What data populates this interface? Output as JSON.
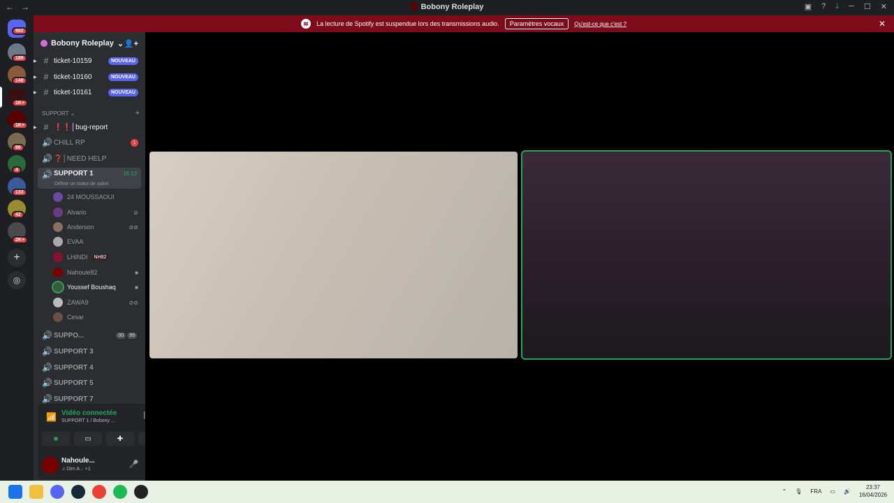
{
  "window": {
    "title": "Bobony Roleplay"
  },
  "banner": {
    "text": "La lecture de Spotify est suspendue lors des transmissions audio.",
    "button_label": "Paramètres vocaux",
    "link_text": "Qu'est-ce que c'est ?"
  },
  "guilds": {
    "badges": [
      "902",
      "189",
      "148",
      "1K+",
      "1K+",
      "86",
      "4",
      "133",
      "42",
      "2K+"
    ]
  },
  "server": {
    "name": "Bobony Roleplay"
  },
  "channels": {
    "tickets": [
      {
        "name": "ticket-10159",
        "badge": "NOUVEAU"
      },
      {
        "name": "ticket-10160",
        "badge": "NOUVEAU"
      },
      {
        "name": "ticket-10161",
        "badge": "NOUVEAU"
      }
    ],
    "category": "SUPPORT",
    "bug_report": "❗❗│bug-report",
    "chill": {
      "name": "CHILL RP",
      "badge": "1"
    },
    "need_help": "❓│NEED HELP",
    "support1": {
      "name": "SUPPORT 1",
      "timer": "16:13",
      "status": "Définir un statut de salon"
    },
    "members": [
      {
        "name": "24 MOUSSAOUI"
      },
      {
        "name": "Alvario"
      },
      {
        "name": "Anderson"
      },
      {
        "name": "EVAA"
      },
      {
        "name": "LHINDI",
        "tag": "NH82"
      },
      {
        "name": "Nahoule82"
      },
      {
        "name": "Youssef Boushaq"
      },
      {
        "name": "ZAWA9"
      },
      {
        "name": "Cesar"
      }
    ],
    "support2": {
      "name": "SUPPO...",
      "counts": [
        "00",
        "99"
      ]
    },
    "others": [
      "SUPPORT 3",
      "SUPPORT 4",
      "SUPPORT 5",
      "SUPPORT 7"
    ]
  },
  "voice": {
    "status": "Vidéo connectée",
    "channel": "SUPPORT 1 / Bobony ..."
  },
  "user": {
    "name": "Nahoule...",
    "status": "Dim A...",
    "extra": "+1"
  },
  "taskbar": {
    "lang": "FRA",
    "time": "23:37",
    "date": "16/04/2026"
  },
  "colors": {
    "accent": "#23a55a",
    "banner": "#7e0b1a",
    "badge": "#5865f2",
    "red": "#f23f43"
  }
}
